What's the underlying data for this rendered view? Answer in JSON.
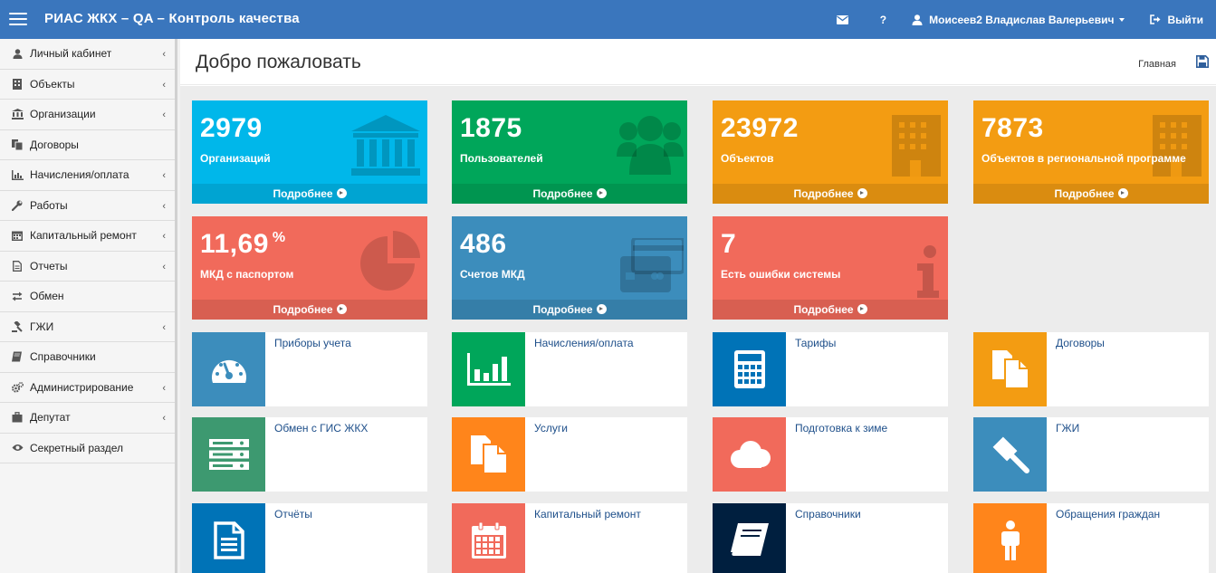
{
  "header": {
    "title": "РИАС ЖКХ – QA – Контроль качества",
    "help": "?",
    "user": "Моисеев2 Владислав Валерьевич",
    "logout": "Выйти"
  },
  "sidebar": {
    "items": [
      {
        "label": "Личный кабинет",
        "icon": "user-icon",
        "has_children": true
      },
      {
        "label": "Объекты",
        "icon": "building-icon",
        "has_children": true
      },
      {
        "label": "Организации",
        "icon": "institution-icon",
        "has_children": true
      },
      {
        "label": "Договоры",
        "icon": "copy-icon",
        "has_children": false
      },
      {
        "label": "Начисления/оплата",
        "icon": "bar-chart-icon",
        "has_children": true
      },
      {
        "label": "Работы",
        "icon": "wrench-icon",
        "has_children": true
      },
      {
        "label": "Капитальный ремонт",
        "icon": "calendar-icon",
        "has_children": true
      },
      {
        "label": "Отчеты",
        "icon": "file-icon",
        "has_children": true
      },
      {
        "label": "Обмен",
        "icon": "exchange-icon",
        "has_children": false
      },
      {
        "label": "ГЖИ",
        "icon": "gavel-icon",
        "has_children": true
      },
      {
        "label": "Справочники",
        "icon": "book-icon",
        "has_children": false
      },
      {
        "label": "Администрирование",
        "icon": "cogs-icon",
        "has_children": true
      },
      {
        "label": "Депутат",
        "icon": "suitcase-icon",
        "has_children": true
      },
      {
        "label": "Секретный раздел",
        "icon": "eye-icon",
        "has_children": false
      }
    ]
  },
  "page": {
    "title": "Добро пожаловать",
    "breadcrumb": "Главная"
  },
  "stats": [
    {
      "value": "2979",
      "unit": "",
      "label": "Организаций",
      "more": "Подробнее",
      "color": "#00b7ea",
      "icon": "institution-icon"
    },
    {
      "value": "1875",
      "unit": "",
      "label": "Пользователей",
      "more": "Подробнее",
      "color": "#00a65a",
      "icon": "users-icon"
    },
    {
      "value": "23972",
      "unit": "",
      "label": "Объектов",
      "more": "Подробнее",
      "color": "#f39c12",
      "icon": "building-icon"
    },
    {
      "value": "7873",
      "unit": "",
      "label": "Объектов в региональной программе",
      "more": "Подробнее",
      "color": "#f39c12",
      "icon": "building-icon"
    },
    {
      "value": "11,69",
      "unit": "%",
      "label": "МКД с паспортом",
      "more": "Подробнее",
      "color": "#f16a5b",
      "icon": "pie-chart-icon"
    },
    {
      "value": "486",
      "unit": "",
      "label": "Счетов МКД",
      "more": "Подробнее",
      "color": "#3c8dbc",
      "icon": "credit-card-icon"
    },
    {
      "value": "7",
      "unit": "",
      "label": "Есть ошибки системы",
      "more": "Подробнее",
      "color": "#f16a5b",
      "icon": "info-icon"
    }
  ],
  "modules": [
    {
      "label": "Приборы учета",
      "color": "#3c8dbc",
      "icon": "dashboard-icon"
    },
    {
      "label": "Начисления/оплата",
      "color": "#00a65a",
      "icon": "bar-chart-icon"
    },
    {
      "label": "Тарифы",
      "color": "#0073b7",
      "icon": "calculator-icon"
    },
    {
      "label": "Договоры",
      "color": "#f39c12",
      "icon": "copy-icon"
    },
    {
      "label": "Обмен с ГИС ЖКХ",
      "color": "#3d9970",
      "icon": "server-icon"
    },
    {
      "label": "Услуги",
      "color": "#ff851b",
      "icon": "copy-icon"
    },
    {
      "label": "Подготовка к зиме",
      "color": "#f16a5b",
      "icon": "cloud-icon"
    },
    {
      "label": "ГЖИ",
      "color": "#3c8dbc",
      "icon": "gavel-icon"
    },
    {
      "label": "Отчёты",
      "color": "#0073b7",
      "icon": "file-text-icon"
    },
    {
      "label": "Капитальный ремонт",
      "color": "#f16a5b",
      "icon": "calendar-icon"
    },
    {
      "label": "Справочники",
      "color": "#001f3f",
      "icon": "book-icon"
    },
    {
      "label": "Обращения граждан",
      "color": "#ff851b",
      "icon": "male-icon"
    }
  ]
}
